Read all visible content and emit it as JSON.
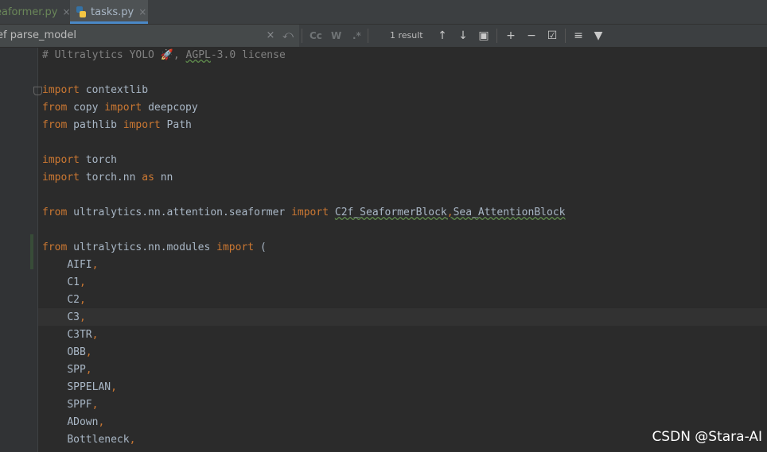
{
  "tabs": [
    {
      "label": "eaformer.py",
      "close": "×"
    },
    {
      "label": "tasks.py",
      "close": "×"
    }
  ],
  "search": {
    "query": "ef parse_model",
    "clear_icon": "×",
    "history_icon": "⤺",
    "match_case": "Cc",
    "words": "W",
    "regex": ".*",
    "results": "1 result",
    "prev_icon": "↑",
    "next_icon": "↓",
    "open_in_window_icon": "▣",
    "add_selection_icon": "+",
    "remove_selection_icon": "−",
    "select_all_icon": "☑",
    "filter_icon": "▼",
    "in_selection_icon": "≡"
  },
  "code": {
    "l1_comment": "# Ultralytics YOLO 🚀, ",
    "l1_license": "AGPL",
    "l1_rest": "-3.0 license",
    "l3_kw": "import",
    "l3_rest": " contextlib",
    "l4_kw1": "from",
    "l4_mod": " copy ",
    "l4_kw2": "import",
    "l4_name": " deepcopy",
    "l5_kw1": "from",
    "l5_mod": " pathlib ",
    "l5_kw2": "import",
    "l5_name": " Path",
    "l7_kw": "import",
    "l7_rest": " torch",
    "l8_kw": "import",
    "l8_mod": " torch.nn ",
    "l8_as": "as",
    "l8_name": " nn",
    "l10_kw1": "from",
    "l10_mod": " ultralytics.nn.attention.seaformer ",
    "l10_kw2": "import",
    "l10_n1": "C2f_SeaformerBlock",
    "l10_comma": ",",
    "l10_n2": "Sea_AttentionBlock",
    "l12_kw1": "from",
    "l12_mod": " ultralytics.nn.modules ",
    "l12_kw2": "import",
    "l12_rest": " (",
    "items": [
      "AIFI",
      "C1",
      "C2",
      "C3",
      "C3TR",
      "OBB",
      "SPP",
      "SPPELAN",
      "SPPF",
      "ADown",
      "Bottleneck"
    ],
    "comma": ","
  },
  "watermark": "CSDN @Stara-AI"
}
